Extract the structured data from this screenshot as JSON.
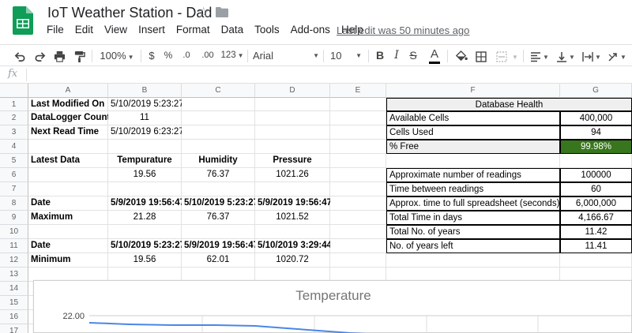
{
  "header": {
    "title": "IoT Weather Station - Dad",
    "last_edit": "Last edit was 50 minutes ago"
  },
  "menu": [
    "File",
    "Edit",
    "View",
    "Insert",
    "Format",
    "Data",
    "Tools",
    "Add-ons",
    "Help"
  ],
  "toolbar": {
    "zoom": "100%",
    "currency": "$",
    "percent": "%",
    "decrease_decimal": ".0",
    "increase_decimal": ".00",
    "more_formats": "123",
    "font": "Arial",
    "font_size": "10",
    "bold": "B",
    "italic": "I",
    "strike": "S",
    "text_color": "A",
    "text_color_hex": "#000000"
  },
  "formula_bar": {
    "icon": "fx"
  },
  "sheet": {
    "columns": [
      "A",
      "B",
      "C",
      "D",
      "E",
      "F",
      "G"
    ],
    "rows": [
      "1",
      "2",
      "3",
      "4",
      "5",
      "6",
      "7",
      "8",
      "9",
      "10",
      "11",
      "12",
      "13",
      "14",
      "15",
      "16",
      "17"
    ],
    "cells": {
      "A1": "Last Modified On",
      "B1": "5/10/2019 5:23:27",
      "A2": "DataLogger Count",
      "B2": "11",
      "A3": "Next Read Time",
      "B3": "5/10/2019 6:23:27",
      "A5": "Latest Data",
      "B5": "Tempurature",
      "C5": "Humidity",
      "D5": "Pressure",
      "B6": "19.56",
      "C6": "76.37",
      "D6": "1021.26",
      "A8": "Date",
      "B8": "5/9/2019 19:56:47",
      "C8": "5/10/2019 5:23:27",
      "D8": "5/9/2019 19:56:47",
      "A9": "Maximum",
      "B9": "21.28",
      "C9": "76.37",
      "D9": "1021.52",
      "A11": "Date",
      "B11": "5/10/2019 5:23:27",
      "C11": "5/9/2019 19:56:47",
      "D11": "5/10/2019 3:29:44",
      "A12": "Minimum",
      "B12": "19.56",
      "C12": "62.01",
      "D12": "1020.72",
      "F1": "Database Health",
      "F2": "Available Cells",
      "G2": "400,000",
      "F3": "Cells Used",
      "G3": "94",
      "F4": "% Free",
      "G4": "99.98%",
      "F6": "Approximate number of readings",
      "G6": "100000",
      "F7": "Time between readings",
      "G7": "60",
      "F8": "Approx. time to full spreadsheet (seconds)",
      "G8": "6,000,000",
      "F9": "Total Time in days",
      "G9": "4,166.67",
      "F10": "Total No. of years",
      "G10": "11.42",
      "F11": "No. of years left",
      "G11": "11.41"
    }
  },
  "chart": {
    "title": "Temperature",
    "y_tick": "22.00",
    "line_color": "#4a86e8"
  },
  "colors": {
    "green_fill": "#38761d",
    "sheets_green": "#0f9d58"
  }
}
